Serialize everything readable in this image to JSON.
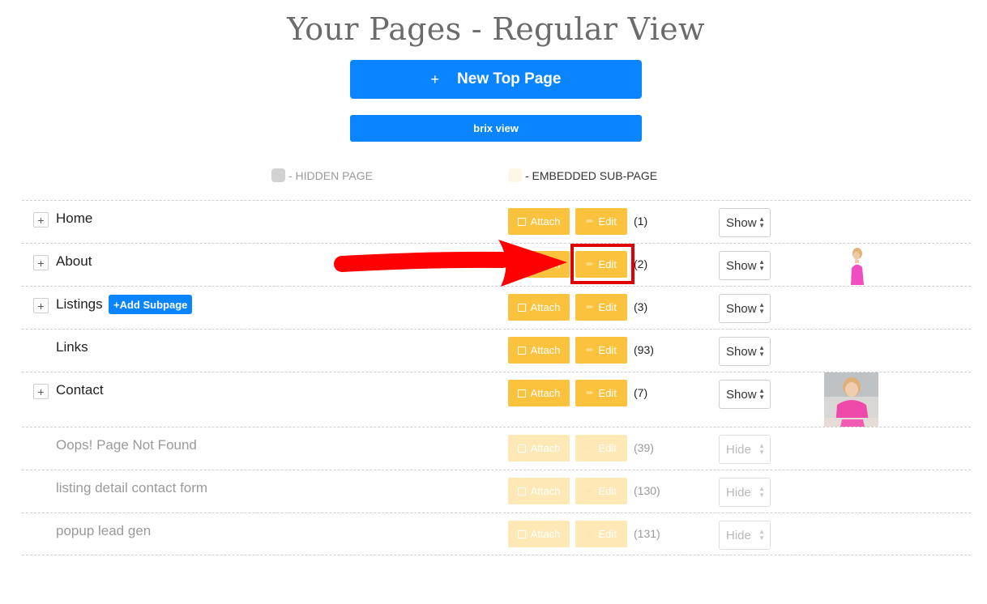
{
  "page": {
    "title": "Your Pages - Regular View",
    "new_top_page_label": "New Top Page",
    "brix_view_label": "brix view"
  },
  "legend": {
    "hidden_label": "- HIDDEN PAGE",
    "embedded_label": "- EMBEDDED SUB-PAGE"
  },
  "buttons": {
    "attach_label": "Attach",
    "edit_label": "Edit",
    "add_subpage_label": "+Add Subpage"
  },
  "rows": [
    {
      "name": "Home",
      "count": "(1)",
      "visibility": "Show"
    },
    {
      "name": "About",
      "count": "(2)",
      "visibility": "Show"
    },
    {
      "name": "Listings",
      "count": "(3)",
      "visibility": "Show"
    },
    {
      "name": "Links",
      "count": "(93)",
      "visibility": "Show"
    },
    {
      "name": "Contact",
      "count": "(7)",
      "visibility": "Show"
    },
    {
      "name": "Oops! Page Not Found",
      "count": "(39)",
      "visibility": "Hide"
    },
    {
      "name": "listing detail contact form",
      "count": "(130)",
      "visibility": "Hide"
    },
    {
      "name": "popup lead gen",
      "count": "(131)",
      "visibility": "Hide"
    }
  ],
  "colors": {
    "primary": "#0a84ff",
    "accent": "#fbc23e",
    "annotation": "#e00000"
  },
  "icons": [
    "plus-icon",
    "checkbox-icon",
    "pencil-icon",
    "select-arrows-icon",
    "annotation-arrow"
  ]
}
